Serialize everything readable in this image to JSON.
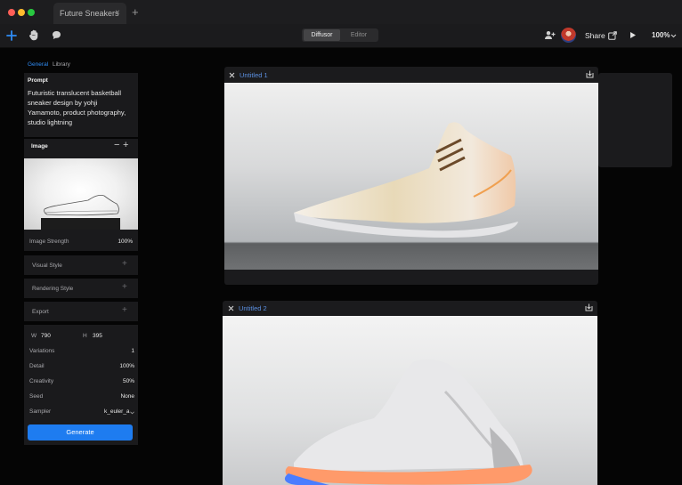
{
  "window": {
    "traffic_colors": [
      "#ff5f57",
      "#febc2e",
      "#28c840"
    ],
    "tab_title": "Future Sneakers",
    "tab_close": "×",
    "new_tab": "+"
  },
  "toolbar": {
    "modes": [
      "Diffusor",
      "Editor"
    ],
    "share_label": "Share",
    "zoom": "100%"
  },
  "sidebar": {
    "tabs": [
      "General",
      "Library"
    ],
    "prompt_title": "Prompt",
    "prompt_text": "Futuristic translucent basketball sneaker design by yohji Yamamoto, product photography, studio lightning",
    "image_title": "Image",
    "image_strength_label": "Image Strength",
    "image_strength_value": "100%",
    "sections": [
      "Visual Style",
      "Rendering Style",
      "Export"
    ],
    "width_label": "W",
    "width_value": "790",
    "height_label": "H",
    "height_value": "395",
    "params": [
      {
        "label": "Variations",
        "value": "1"
      },
      {
        "label": "Detail",
        "value": "100%"
      },
      {
        "label": "Creativity",
        "value": "50%"
      },
      {
        "label": "Seed",
        "value": "None"
      },
      {
        "label": "Sampler",
        "value": "k_euler_a"
      }
    ],
    "generate_label": "Generate"
  },
  "canvases": [
    {
      "title": "Untitled 1"
    },
    {
      "title": "Untitled 2"
    }
  ],
  "accent": "#1e7cf0"
}
